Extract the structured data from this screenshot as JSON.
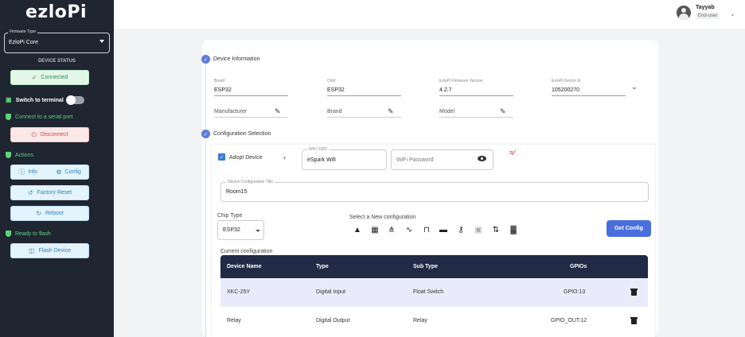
{
  "app": {
    "logo": "ezloPi"
  },
  "sidebar": {
    "firmware": {
      "legend": "Firmware Type",
      "value": "EzloPi Core"
    },
    "device_status_label": "DEVICE STATUS",
    "connected_label": "Connected",
    "switch_terminal_label": "Switch to terminal",
    "connect_serial_label": "Connect to a serial port",
    "disconnect_label": "Disconnect",
    "actions_label": "Actions",
    "info_label": "Info",
    "config_label": "Config",
    "factory_reset_label": "Factory Reset",
    "reboot_label": "Reboot",
    "ready_flash_label": "Ready to flash",
    "flash_device_label": "Flash Device"
  },
  "user": {
    "name": "Tayyab",
    "role": "End-user"
  },
  "device_info": {
    "title": "Device Information",
    "board": {
      "label": "Board",
      "value": "ESP32"
    },
    "chip": {
      "label": "Chid",
      "value": "ESP32"
    },
    "firmware_version": {
      "label": "EzloPi Firmware Version",
      "value": "4.2.7"
    },
    "device_id": {
      "label": "EzloPi Device Id",
      "value": "105200270"
    },
    "manufacturer_placeholder": "Manufacturer",
    "brand_placeholder": "Brand",
    "model_placeholder": "Model"
  },
  "configuration": {
    "title": "Configuration Selection",
    "adopt_label": "Adopt Device",
    "wifi_ssid": {
      "legend": "WiFi SSID",
      "value": "eSpark Wifi"
    },
    "wifi_password_placeholder": "WiFi Password",
    "config_title": {
      "legend": "Device Configuration Title",
      "value": "Room15"
    },
    "chip_type_label": "Chip Type",
    "chip_type_value": "ESP32",
    "new_config_label": "Select a New configuration",
    "get_config_label": "Get Config",
    "current_config_label": "Current configuration",
    "table": {
      "headers": [
        "Device Name",
        "Type",
        "Sub Type",
        "GPIOs"
      ],
      "rows": [
        [
          "XKC-25Y",
          "Digital Input",
          "Float Switch",
          "GPIO:13"
        ],
        [
          "Relay",
          "Digital Output",
          "Relay",
          "GPIO_OUT:12"
        ]
      ]
    }
  },
  "device_type_icons": [
    "led-icon",
    "sensor-icon",
    "switch-icon",
    "dimmer-icon",
    "relay-icon",
    "uart-icon",
    "antenna-icon",
    "display-icon",
    "i2c-icon",
    "multi-relay-icon"
  ],
  "colors": {
    "sidebar_bg": "#1f2531",
    "accent": "#4a6fdc",
    "success": "#5cd37a",
    "danger": "#d04545",
    "table_header": "#212b45",
    "row_highlight": "#e9ebfb"
  }
}
